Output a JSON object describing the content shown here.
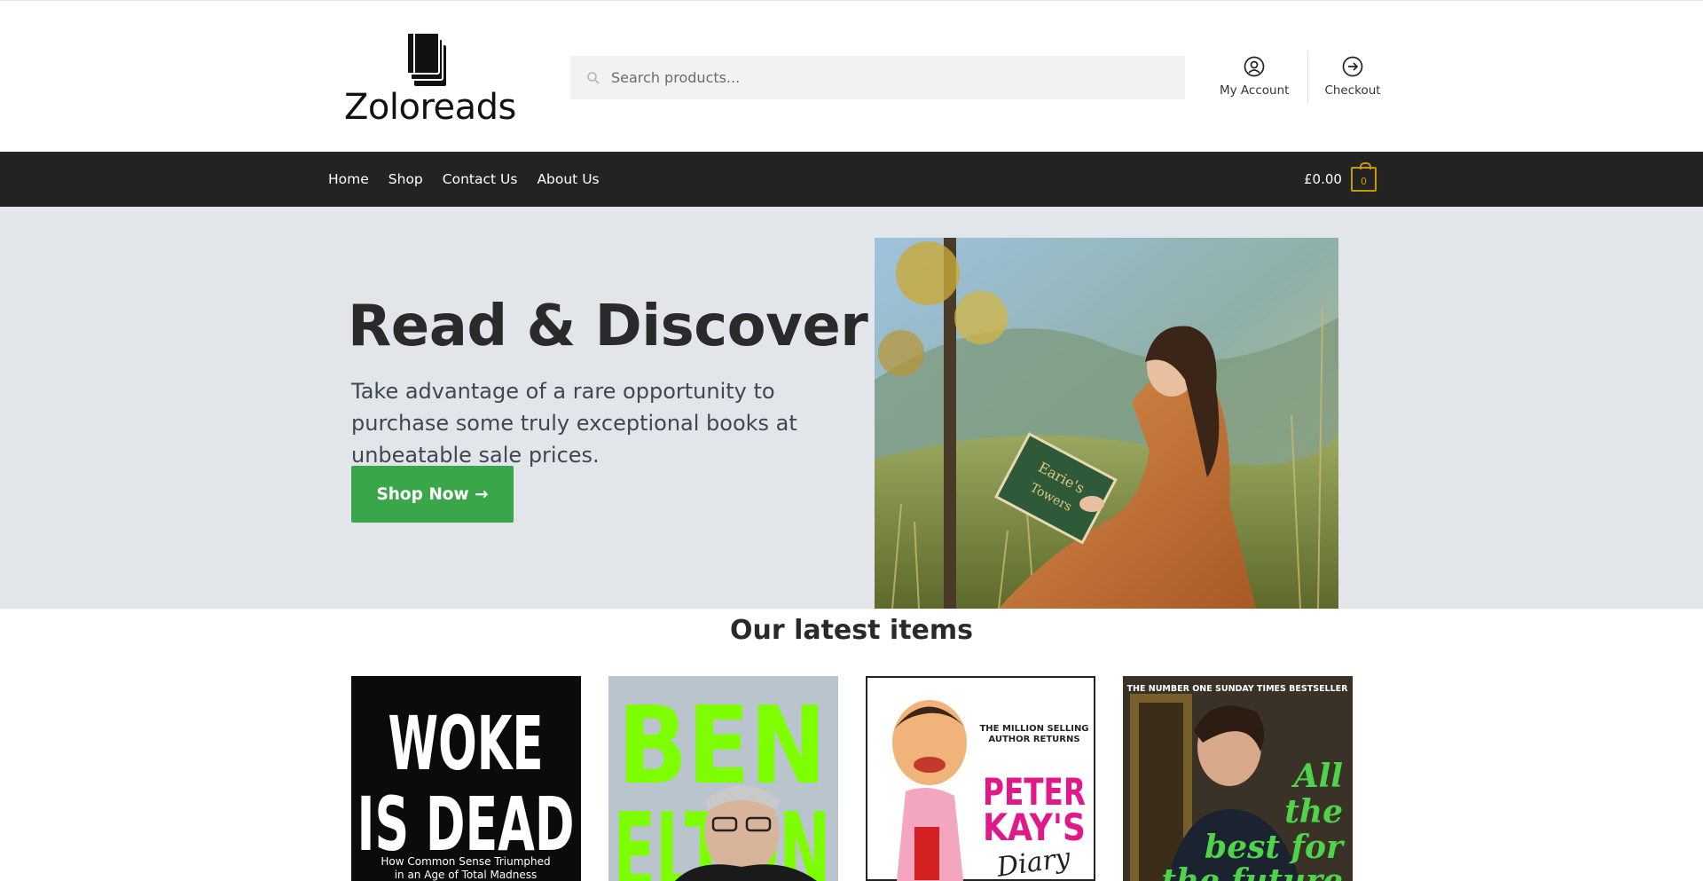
{
  "header": {
    "logo_text": "Zoloreads",
    "search_placeholder": "Search products...",
    "links": [
      {
        "label": "My Account",
        "icon": "user-circle-icon"
      },
      {
        "label": "Checkout",
        "icon": "arrow-right-circle-icon"
      }
    ]
  },
  "nav": {
    "items": [
      "Home",
      "Shop",
      "Contact Us",
      "About Us"
    ],
    "cart_total": "£0.00",
    "cart_count": "0"
  },
  "hero": {
    "title": "Read & Discover",
    "text": "Take advantage of a rare opportunity to purchase some truly exceptional books at unbeatable sale prices.",
    "button_label": "Shop Now →",
    "image_book_title": "Earie's",
    "image_book_title_2": "Towers"
  },
  "latest": {
    "title": "Our latest items",
    "products": [
      {
        "cover_line_1": "WOKE",
        "cover_line_2": "IS DEAD",
        "cover_sub_1": "How Common Sense Triumphed",
        "cover_sub_2": "in an Age of Total Madness"
      },
      {
        "cover_line_1": "BEN",
        "cover_line_2": "ELTON"
      },
      {
        "cover_top_1": "THE MILLION SELLING",
        "cover_top_2": "AUTHOR RETURNS",
        "cover_line_1": "PETER",
        "cover_line_2": "KAY'S",
        "cover_script": "Diary"
      },
      {
        "cover_top": "THE NUMBER ONE SUNDAY TIMES BESTSELLER",
        "cover_line_1": "All",
        "cover_line_2": "the",
        "cover_line_3": "best for",
        "cover_line_4": "the future"
      }
    ]
  },
  "colors": {
    "nav_bg": "#232323",
    "hero_bg": "#e2e6eb",
    "button_green": "#3aa64a",
    "cart_accent": "#c79a00"
  }
}
